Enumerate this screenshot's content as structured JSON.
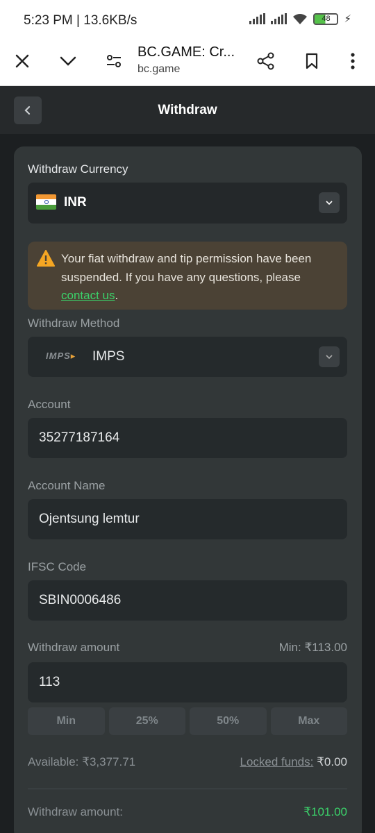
{
  "status_bar": {
    "time": "5:23 PM | 13.6KB/s",
    "battery": "48"
  },
  "browser": {
    "title": "BC.GAME: Cr...",
    "url": "bc.game"
  },
  "page": {
    "title": "Withdraw"
  },
  "currency": {
    "label": "Withdraw Currency",
    "value": "INR"
  },
  "warning": {
    "text_before": "Your fiat withdraw and tip permission have been suspended. If you have any questions, please ",
    "link": "contact us",
    "text_after": "."
  },
  "method": {
    "label": "Withdraw Method",
    "logo_text": "IMPS",
    "value": "IMPS"
  },
  "account": {
    "label": "Account",
    "value": "35277187164"
  },
  "account_name": {
    "label": "Account Name",
    "value": "Ojentsung lemtur"
  },
  "ifsc": {
    "label": "IFSC Code",
    "value": "SBIN0006486"
  },
  "amount": {
    "label": "Withdraw amount",
    "min_text": "Min: ₹113.00",
    "value": "113",
    "chips": [
      "Min",
      "25%",
      "50%",
      "Max"
    ]
  },
  "funds": {
    "available": "Available: ₹3,377.71",
    "locked_label": "Locked funds:",
    "locked_value": "₹0.00"
  },
  "summary": {
    "label": "Withdraw amount:",
    "value": "₹101.00"
  },
  "colors": {
    "accent_green": "#3bd26a",
    "warning_bg": "#4b4235",
    "card_bg": "#323738"
  }
}
